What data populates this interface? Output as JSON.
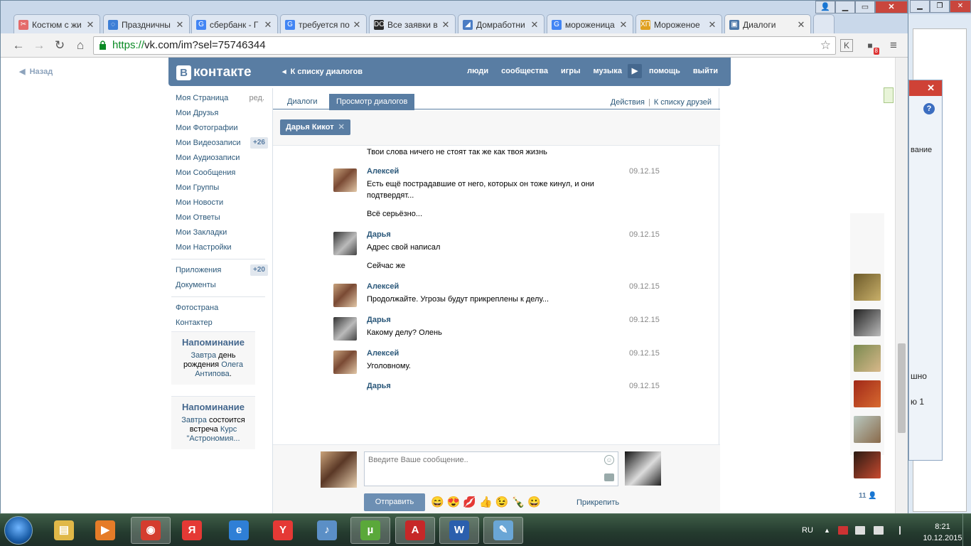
{
  "browser": {
    "tabs": [
      {
        "title": "Костюм с жи",
        "favicon_color": "#e46b6b",
        "favicon_glyph": "✂"
      },
      {
        "title": "Праздничны",
        "favicon_color": "#3d7fd6",
        "favicon_glyph": "◌"
      },
      {
        "title": "сбербанк - Г",
        "favicon_color": "#4285f4",
        "favicon_glyph": "G"
      },
      {
        "title": "требуется по",
        "favicon_color": "#4285f4",
        "favicon_glyph": "G"
      },
      {
        "title": "Все заявки в",
        "favicon_color": "#2b2b2b",
        "favicon_glyph": "DO"
      },
      {
        "title": "Домработни",
        "favicon_color": "#4a7cc4",
        "favicon_glyph": "◢"
      },
      {
        "title": "мороженица",
        "favicon_color": "#4285f4",
        "favicon_glyph": "G"
      },
      {
        "title": "Мороженое",
        "favicon_color": "#e0a020",
        "favicon_glyph": "ХП"
      },
      {
        "title": "Диалоги",
        "favicon_color": "#4a76a8",
        "favicon_glyph": "▣"
      }
    ],
    "active_tab": 8,
    "url_scheme": "https://",
    "url_rest": "vk.com/im?sel=75746344",
    "extension_badge": "8"
  },
  "vk": {
    "back": "Назад",
    "logo_b": "В",
    "logo_text": "контакте",
    "to_dialogs": "К списку диалогов",
    "nav": [
      "люди",
      "сообщества",
      "игры",
      "музыка",
      "помощь",
      "выйти"
    ],
    "sidebar": [
      {
        "label": "Моя Страница",
        "extra": "ред."
      },
      {
        "label": "Мои Друзья"
      },
      {
        "label": "Мои Фотографии"
      },
      {
        "label": "Мои Видеозаписи",
        "count": "+26"
      },
      {
        "label": "Мои Аудиозаписи"
      },
      {
        "label": "Мои Сообщения"
      },
      {
        "label": "Мои Группы"
      },
      {
        "label": "Мои Новости"
      },
      {
        "label": "Мои Ответы"
      },
      {
        "label": "Мои Закладки"
      },
      {
        "label": "Мои Настройки"
      }
    ],
    "sidebar2": [
      {
        "label": "Приложения",
        "count": "+20"
      },
      {
        "label": "Документы"
      }
    ],
    "sidebar3": [
      {
        "label": "Фотострана"
      },
      {
        "label": "Контактер"
      }
    ],
    "reminders": [
      {
        "title": "Напоминание",
        "p1": "Завтра",
        "p2": " день рождения ",
        "p3": "Олега Антипова",
        "p4": "."
      },
      {
        "title": "Напоминание",
        "p1": "Завтра",
        "p2": " состоится встреча ",
        "p3": "Курс \"Астрономия...",
        "p4": ""
      }
    ],
    "tabs": {
      "dialogs": "Диалоги",
      "view": "Просмотр диалогов",
      "actions": "Действия",
      "sep": "|",
      "friends": "К списку друзей"
    },
    "peer_chip": "Дарья Кикот",
    "top_cut_text": "Твои слова ничего не стоят так же как твоя жизнь",
    "messages": [
      {
        "who": "A",
        "name": "Алексей",
        "date": "09.12.15",
        "lines": [
          "Есть ещё пострадавшие от него, которых он тоже кинул, и они подтвердят...",
          "Всё серьёзно..."
        ]
      },
      {
        "who": "D",
        "name": "Дарья",
        "date": "09.12.15",
        "lines": [
          "Адрес свой написал",
          "Сейчас же"
        ]
      },
      {
        "who": "A",
        "name": "Алексей",
        "date": "09.12.15",
        "lines": [
          "Продолжайте. Угрозы будут прикреплены к делу..."
        ]
      },
      {
        "who": "D",
        "name": "Дарья",
        "date": "09.12.15",
        "lines": [
          "Какому делу? Олень"
        ]
      },
      {
        "who": "A",
        "name": "Алексей",
        "date": "09.12.15",
        "lines": [
          "Уголовному."
        ]
      },
      {
        "who": "D",
        "name": "Дарья",
        "date": "09.12.15",
        "lines": []
      }
    ],
    "compose": {
      "placeholder": "Введите Ваше сообщение..",
      "send": "Отправить",
      "attach": "Прикрепить",
      "emojis": [
        "😄",
        "😍",
        "💋",
        "👍",
        "😉",
        "🍾",
        "😀"
      ]
    },
    "friends_count": "11"
  },
  "right_window": {
    "text_fragment": "вание",
    "cut1": "шно",
    "cut2": "ю 1"
  },
  "taskbar": {
    "apps": [
      {
        "name": "explorer",
        "color": "#e0b848",
        "glyph": "▤"
      },
      {
        "name": "media-player",
        "color": "#e57c28",
        "glyph": "▶"
      },
      {
        "name": "chrome",
        "color": "#d43d2f",
        "glyph": "◉"
      },
      {
        "name": "yandex-browser",
        "color": "#e53935",
        "glyph": "Я"
      },
      {
        "name": "internet-explorer",
        "color": "#2f7fd6",
        "glyph": "e"
      },
      {
        "name": "yandex",
        "color": "#e53935",
        "glyph": "Y"
      },
      {
        "name": "volume",
        "color": "#5b8fc6",
        "glyph": "♪"
      },
      {
        "name": "utorrent",
        "color": "#5aa83a",
        "glyph": "µ"
      },
      {
        "name": "acrobat",
        "color": "#c62828",
        "glyph": "A"
      },
      {
        "name": "word",
        "color": "#2b5fad",
        "glyph": "W"
      },
      {
        "name": "paint",
        "color": "#6aa6d6",
        "glyph": "✎"
      }
    ],
    "lang": "RU",
    "time": "8:21",
    "date": "10.12.2015"
  }
}
